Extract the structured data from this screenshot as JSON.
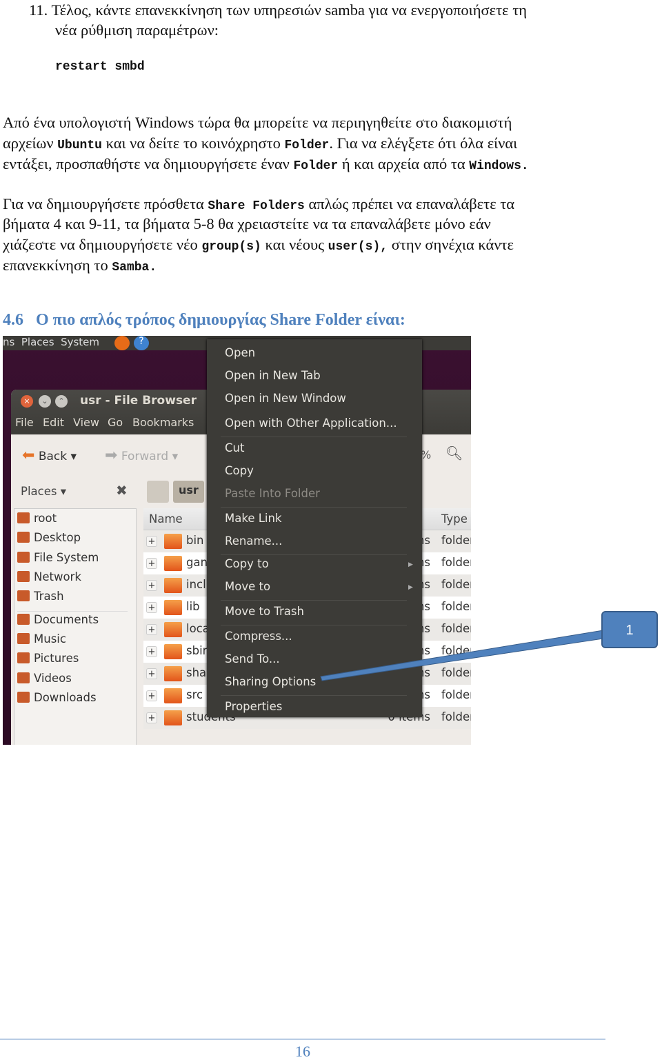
{
  "doc": {
    "step11": {
      "number": "11.",
      "line1": "Τέλος, κάντε επανεκκίνηση των υπηρεσιών samba για να ενεργοποιήσετε τη",
      "line2": "νέα ρύθμιση παραμέτρων:",
      "command": "restart smbd"
    },
    "para1": {
      "a": "Από ένα υπολογιστή Windows τώρα θα μπορείτε να περιηγηθείτε στο διακομιστή",
      "b1": "αρχείων ",
      "b2": "Ubuntu",
      "b3": " και να δείτε το κοινόχρηστο ",
      "b4": "Folder",
      "b5": ". Για να ελέγξετε ότι όλα είναι",
      "c1": "εντάξει, προσπαθήστε να δημιουργήσετε έναν ",
      "c2": "Folder",
      "c3": " ή και αρχεία από τα ",
      "c4": "Windows."
    },
    "para2": {
      "a1": "Για να δημιουργήσετε πρόσθετα ",
      "a2": "Share Folders",
      "a3": " απλώς πρέπει να επαναλάβετε τα",
      "b": "βήματα 4 και 9-11, τα βήματα 5-8 θα χρειαστείτε να τα επαναλάβετε μόνο εάν",
      "c1": "χιάζεστε να δημιουργήσετε νέο ",
      "c2": "group(s)",
      "c3": " και νέους ",
      "c4": "user(s),",
      "c5": " στην σηνέχια κάντε",
      "d1": "επανεκκίνηση το ",
      "d2": "Samba."
    },
    "heading": {
      "number": "4.6",
      "text": "Ο πιο απλός τρόπος δημιουργίας Share Folder είναι:"
    },
    "page_number": "16",
    "callout_label": "1"
  },
  "screenshot": {
    "panel": {
      "items": "ns  Places  System"
    },
    "window": {
      "title": "usr - File Browser",
      "menubar": [
        "File",
        "Edit",
        "View",
        "Go",
        "Bookmarks"
      ],
      "toolbar": {
        "back": "Back",
        "forward": "Forward",
        "zoom": "%"
      },
      "location": {
        "places": "Places",
        "crumb": "usr"
      },
      "sidebar": [
        "root",
        "Desktop",
        "File System",
        "Network",
        "Trash",
        "Documents",
        "Music",
        "Pictures",
        "Videos",
        "Downloads"
      ],
      "columns": {
        "name": "Name",
        "type": "Type"
      },
      "rows": [
        {
          "name": "bin",
          "size": "ms",
          "type": "folder"
        },
        {
          "name": "gan",
          "size": "ms",
          "type": "folder"
        },
        {
          "name": "incl",
          "size": "ms",
          "type": "folder"
        },
        {
          "name": "lib",
          "size": "ms",
          "type": "folder"
        },
        {
          "name": "loca",
          "size": "ms",
          "type": "folder"
        },
        {
          "name": "sbir",
          "size": "ms",
          "type": "folder"
        },
        {
          "name": "sha",
          "size": "ms",
          "type": "folder"
        },
        {
          "name": "src",
          "size": "ms",
          "type": "folder"
        },
        {
          "name": "students",
          "size": "0 items",
          "type": "folder"
        }
      ]
    },
    "context_menu": [
      {
        "label": "Open"
      },
      {
        "label": "Open in New Tab"
      },
      {
        "label": "Open in New Window"
      },
      {
        "label": "Open with Other Application..."
      },
      {
        "label": "Cut"
      },
      {
        "label": "Copy"
      },
      {
        "label": "Paste Into Folder",
        "disabled": true
      },
      {
        "label": "Make Link"
      },
      {
        "label": "Rename..."
      },
      {
        "label": "Copy to",
        "submenu": true
      },
      {
        "label": "Move to",
        "submenu": true
      },
      {
        "label": "Move to Trash"
      },
      {
        "label": "Compress..."
      },
      {
        "label": "Send To..."
      },
      {
        "label": "Sharing Options"
      },
      {
        "label": "Properties"
      }
    ]
  },
  "colors": {
    "heading": "#4f81bd",
    "callout": "#4f81bd",
    "menu_bg": "#3c3b37",
    "desktop": "#2c0a24"
  }
}
